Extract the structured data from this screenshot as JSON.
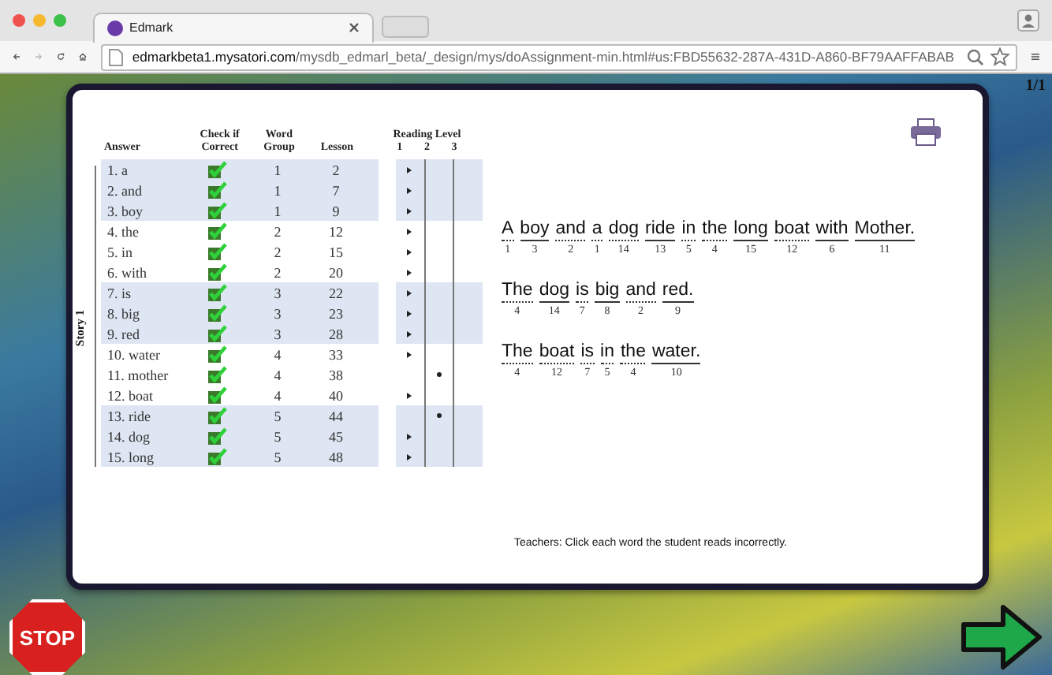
{
  "browser": {
    "tab_title": "Edmark",
    "url_host": "edmarkbeta1.mysatori.com",
    "url_path": "/mysdb_edmarl_beta/_design/mys/doAssignment-min.html#us:FBD55632-287A-431D-A860-BF79AAFFABAB"
  },
  "page_counter": "1/1",
  "table": {
    "columns": {
      "answer": "Answer",
      "check": [
        "Check if",
        "Correct"
      ],
      "group": [
        "Word",
        "Group"
      ],
      "lesson": "Lesson",
      "reading": "Reading Level",
      "levels": [
        "1",
        "2",
        "3"
      ]
    },
    "story_label": "Story 1",
    "rows": [
      {
        "answer": "1. a",
        "checked": true,
        "group": "1",
        "lesson": "2",
        "marks": [
          true,
          false,
          false
        ],
        "shaded": true
      },
      {
        "answer": "2. and",
        "checked": true,
        "group": "1",
        "lesson": "7",
        "marks": [
          true,
          false,
          false
        ],
        "shaded": true
      },
      {
        "answer": "3. boy",
        "checked": true,
        "group": "1",
        "lesson": "9",
        "marks": [
          true,
          false,
          false
        ],
        "shaded": true
      },
      {
        "answer": "4. the",
        "checked": true,
        "group": "2",
        "lesson": "12",
        "marks": [
          true,
          false,
          false
        ],
        "shaded": false
      },
      {
        "answer": "5. in",
        "checked": true,
        "group": "2",
        "lesson": "15",
        "marks": [
          true,
          false,
          false
        ],
        "shaded": false
      },
      {
        "answer": "6. with",
        "checked": true,
        "group": "2",
        "lesson": "20",
        "marks": [
          true,
          false,
          false
        ],
        "shaded": false
      },
      {
        "answer": "7. is",
        "checked": true,
        "group": "3",
        "lesson": "22",
        "marks": [
          true,
          false,
          false
        ],
        "shaded": true
      },
      {
        "answer": "8. big",
        "checked": true,
        "group": "3",
        "lesson": "23",
        "marks": [
          true,
          false,
          false
        ],
        "shaded": true
      },
      {
        "answer": "9. red",
        "checked": true,
        "group": "3",
        "lesson": "28",
        "marks": [
          true,
          false,
          false
        ],
        "shaded": true
      },
      {
        "answer": "10. water",
        "checked": true,
        "group": "4",
        "lesson": "33",
        "marks": [
          true,
          false,
          false
        ],
        "shaded": false
      },
      {
        "answer": "11. mother",
        "checked": true,
        "group": "4",
        "lesson": "38",
        "marks": [
          false,
          true,
          false
        ],
        "shaded": false
      },
      {
        "answer": "12. boat",
        "checked": true,
        "group": "4",
        "lesson": "40",
        "marks": [
          true,
          false,
          false
        ],
        "shaded": false
      },
      {
        "answer": "13. ride",
        "checked": true,
        "group": "5",
        "lesson": "44",
        "marks": [
          false,
          true,
          false
        ],
        "shaded": true
      },
      {
        "answer": "14. dog",
        "checked": true,
        "group": "5",
        "lesson": "45",
        "marks": [
          true,
          false,
          false
        ],
        "shaded": true
      },
      {
        "answer": "15. long",
        "checked": true,
        "group": "5",
        "lesson": "48",
        "marks": [
          true,
          false,
          false
        ],
        "shaded": true
      }
    ]
  },
  "sentences": [
    {
      "words": [
        {
          "text": "A",
          "number": "1",
          "solid": false
        },
        {
          "text": "boy",
          "number": "3",
          "solid": true
        },
        {
          "text": "and",
          "number": "2",
          "solid": false
        },
        {
          "text": "a",
          "number": "1",
          "solid": false
        },
        {
          "text": "dog",
          "number": "14",
          "solid": false
        },
        {
          "text": "ride",
          "number": "13",
          "solid": true
        },
        {
          "text": "in",
          "number": "5",
          "solid": false
        },
        {
          "text": "the",
          "number": "4",
          "solid": false
        },
        {
          "text": "long",
          "number": "15",
          "solid": true
        },
        {
          "text": "boat",
          "number": "12",
          "solid": false
        },
        {
          "text": "with",
          "number": "6",
          "solid": true
        },
        {
          "text": "Mother.",
          "number": "11",
          "solid": true
        }
      ]
    },
    {
      "words": [
        {
          "text": "The",
          "number": "4",
          "solid": false
        },
        {
          "text": "dog",
          "number": "14",
          "solid": true
        },
        {
          "text": "is",
          "number": "7",
          "solid": false
        },
        {
          "text": "big",
          "number": "8",
          "solid": true
        },
        {
          "text": "and",
          "number": "2",
          "solid": false
        },
        {
          "text": "red.",
          "number": "9",
          "solid": true
        }
      ]
    },
    {
      "words": [
        {
          "text": "The",
          "number": "4",
          "solid": false
        },
        {
          "text": "boat",
          "number": "12",
          "solid": false
        },
        {
          "text": "is",
          "number": "7",
          "solid": false
        },
        {
          "text": "in",
          "number": "5",
          "solid": false
        },
        {
          "text": "the",
          "number": "4",
          "solid": false
        },
        {
          "text": "water.",
          "number": "10",
          "solid": true
        }
      ]
    }
  ],
  "instruction": "Teachers: Click each word the student reads incorrectly.",
  "stop_button": "STOP"
}
